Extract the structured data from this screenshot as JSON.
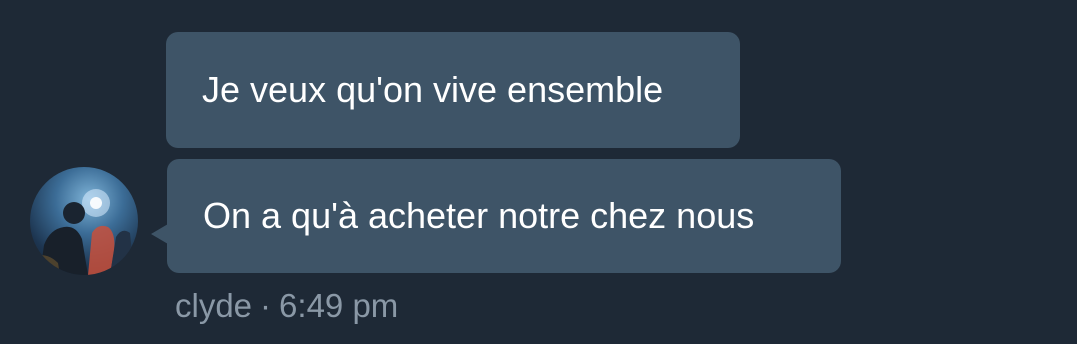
{
  "conversation": {
    "messages": [
      {
        "text": "Je veux qu'on vive ensemble"
      },
      {
        "text": "On a qu'à acheter notre chez nous"
      }
    ],
    "sender": {
      "name": "clyde",
      "separator": "·",
      "time": "6:49 pm"
    }
  },
  "colors": {
    "background": "#1e2936",
    "bubble": "#3e5467",
    "bubble_text": "#ffffff",
    "meta_text": "#8a98a6"
  }
}
